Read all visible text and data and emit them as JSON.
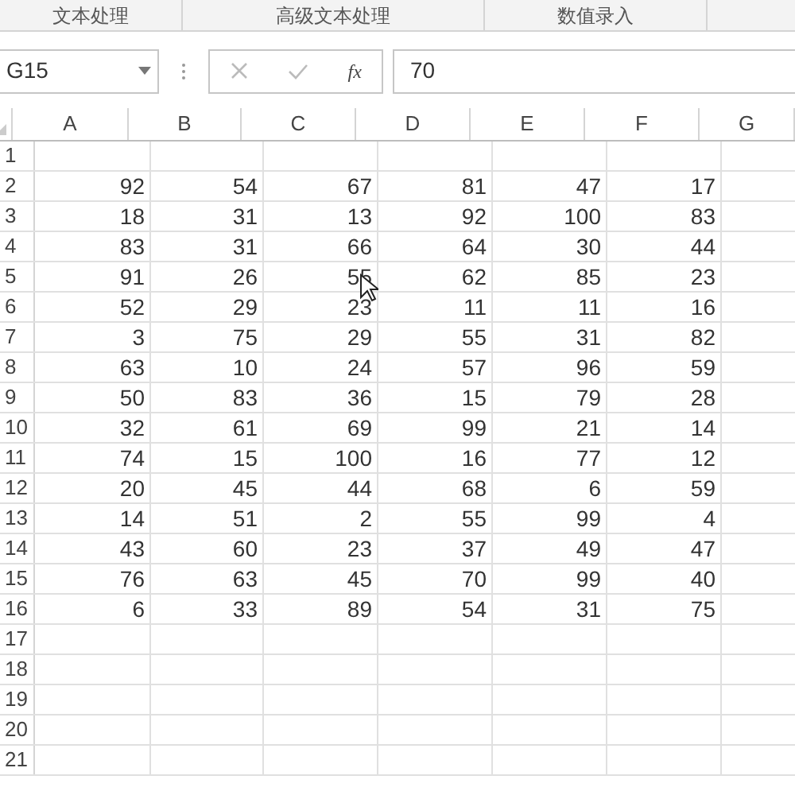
{
  "ribbon_groups": [
    "文本处理",
    "高级文本处理",
    "数值录入"
  ],
  "name_box": "G15",
  "formula_button": "fx",
  "formula_value": "70",
  "columns": [
    "A",
    "B",
    "C",
    "D",
    "E",
    "F",
    "G"
  ],
  "rows": [
    {
      "label": "1",
      "cells": []
    },
    {
      "label": "2",
      "cells": [
        "92",
        "54",
        "67",
        "81",
        "47",
        "17"
      ]
    },
    {
      "label": "3",
      "cells": [
        "18",
        "31",
        "13",
        "92",
        "100",
        "83"
      ]
    },
    {
      "label": "4",
      "cells": [
        "83",
        "31",
        "66",
        "64",
        "30",
        "44"
      ]
    },
    {
      "label": "5",
      "cells": [
        "91",
        "26",
        "55",
        "62",
        "85",
        "23"
      ]
    },
    {
      "label": "6",
      "cells": [
        "52",
        "29",
        "23",
        "11",
        "11",
        "16"
      ]
    },
    {
      "label": "7",
      "cells": [
        "3",
        "75",
        "29",
        "55",
        "31",
        "82"
      ]
    },
    {
      "label": "8",
      "cells": [
        "63",
        "10",
        "24",
        "57",
        "96",
        "59"
      ]
    },
    {
      "label": "9",
      "cells": [
        "50",
        "83",
        "36",
        "15",
        "79",
        "28"
      ]
    },
    {
      "label": "10",
      "cells": [
        "32",
        "61",
        "69",
        "99",
        "21",
        "14"
      ]
    },
    {
      "label": "11",
      "cells": [
        "74",
        "15",
        "100",
        "16",
        "77",
        "12"
      ]
    },
    {
      "label": "12",
      "cells": [
        "20",
        "45",
        "44",
        "68",
        "6",
        "59"
      ]
    },
    {
      "label": "13",
      "cells": [
        "14",
        "51",
        "2",
        "55",
        "99",
        "4"
      ]
    },
    {
      "label": "14",
      "cells": [
        "43",
        "60",
        "23",
        "37",
        "49",
        "47"
      ]
    },
    {
      "label": "15",
      "cells": [
        "76",
        "63",
        "45",
        "70",
        "99",
        "40"
      ]
    },
    {
      "label": "16",
      "cells": [
        "6",
        "33",
        "89",
        "54",
        "31",
        "75"
      ]
    },
    {
      "label": "17",
      "cells": []
    },
    {
      "label": "18",
      "cells": []
    },
    {
      "label": "19",
      "cells": []
    },
    {
      "label": "20",
      "cells": []
    },
    {
      "label": "21",
      "cells": []
    }
  ]
}
